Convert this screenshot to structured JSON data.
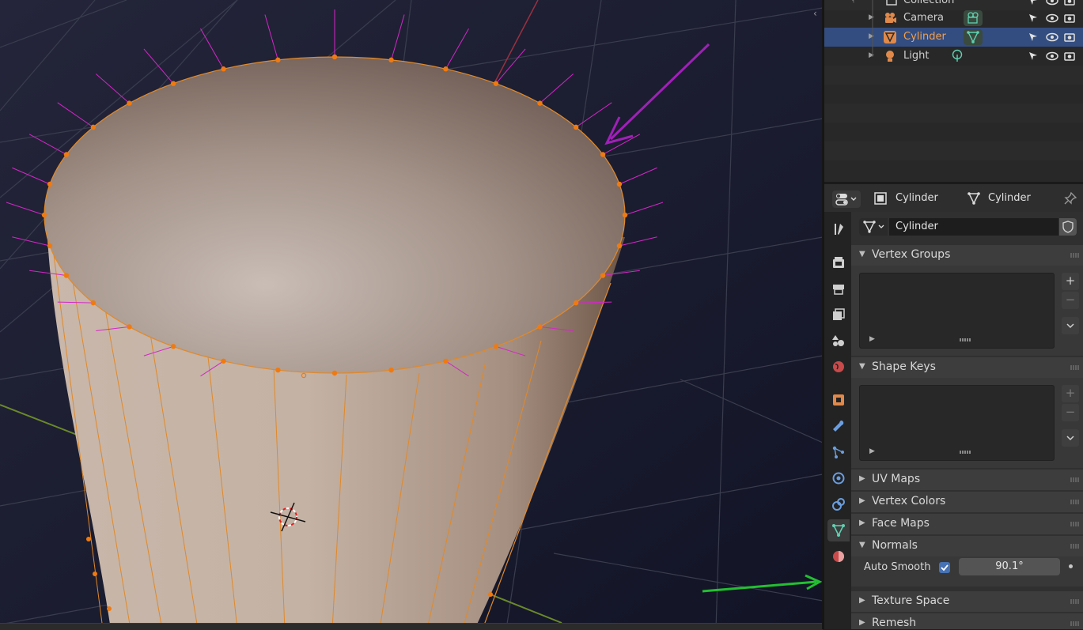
{
  "viewport": {
    "toggle_glyph": "‹",
    "annotations": {
      "top_arrow_color": "#a020b8",
      "bottom_arrow_color": "#22c030"
    },
    "colors": {
      "mesh_fill": "#8f7a6e",
      "vertex": "#f07a10",
      "edge": "#e0892a",
      "normal": "#d427c8",
      "grid": "#3a3d4e"
    }
  },
  "outliner": {
    "rows": [
      {
        "label": "Collection",
        "icon": "collection-icon",
        "active": false,
        "selected": false
      },
      {
        "label": "Camera",
        "icon": "camera-icon",
        "data_icon": "camera-data-icon",
        "active": false,
        "selected": false
      },
      {
        "label": "Cylinder",
        "icon": "mesh-object-icon",
        "data_icon": "mesh-data-icon",
        "active": true,
        "selected": true
      },
      {
        "label": "Light",
        "icon": "light-icon",
        "data_icon": "light-data-icon",
        "active": false,
        "selected": false
      }
    ]
  },
  "properties": {
    "breadcrumb": {
      "object_name": "Cylinder",
      "mesh_name": "Cylinder"
    },
    "mesh_datablock": "Cylinder",
    "panels": {
      "vertex_groups": "Vertex Groups",
      "shape_keys": "Shape Keys",
      "uv_maps": "UV Maps",
      "vertex_colors": "Vertex Colors",
      "face_maps": "Face Maps",
      "normals": "Normals",
      "texture_space": "Texture Space",
      "remesh": "Remesh"
    },
    "normals": {
      "auto_smooth_label": "Auto Smooth",
      "auto_smooth_checked": true,
      "angle": "90.1°"
    },
    "list_controls": {
      "add": "+",
      "remove": "−",
      "menu": "⌄"
    },
    "tabs": [
      "tool-tab-icon",
      "render-tab-icon",
      "output-tab-icon",
      "view-layer-tab-icon",
      "scene-tab-icon",
      "world-tab-icon",
      "object-tab-icon",
      "modifier-tab-icon",
      "particles-tab-icon",
      "physics-tab-icon",
      "constraints-tab-icon",
      "data-tab-icon",
      "material-tab-icon"
    ],
    "active_tab": "data-tab-icon"
  }
}
